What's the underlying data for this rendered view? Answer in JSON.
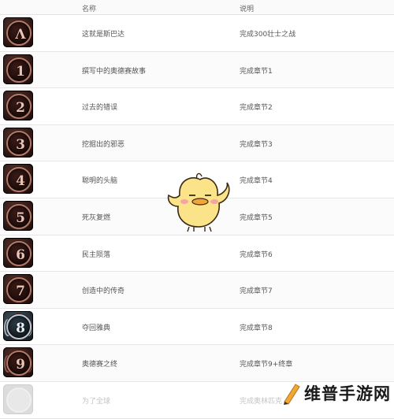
{
  "header": {
    "name_col": "名称",
    "desc_col": "说明"
  },
  "rows": [
    {
      "badge": "spartan-helmet-badge",
      "badge_text": "Λ",
      "name": "这就是斯巴达",
      "desc": "完成300壮士之战"
    },
    {
      "badge": "chapter-1-badge",
      "badge_text": "1",
      "name": "撰写中的奥德赛故事",
      "desc": "完成章节1"
    },
    {
      "badge": "chapter-2-badge",
      "badge_text": "2",
      "name": "过去的错误",
      "desc": "完成章节2"
    },
    {
      "badge": "chapter-3-badge",
      "badge_text": "3",
      "name": "挖掘出的邪恶",
      "desc": "完成章节3"
    },
    {
      "badge": "chapter-4-badge",
      "badge_text": "4",
      "name": "聪明的头脑",
      "desc": "完成章节4"
    },
    {
      "badge": "chapter-5-badge",
      "badge_text": "5",
      "name": "死灰复燃",
      "desc": "完成章节5"
    },
    {
      "badge": "chapter-6-badge",
      "badge_text": "6",
      "name": "民主陨落",
      "desc": "完成章节6"
    },
    {
      "badge": "chapter-7-badge",
      "badge_text": "7",
      "name": "创造中的传奇",
      "desc": "完成章节7"
    },
    {
      "badge": "chapter-8-badge",
      "badge_text": "8",
      "name": "夺回雅典",
      "desc": "完成章节8"
    },
    {
      "badge": "chapter-9-badge",
      "badge_text": "9",
      "name": "奥德赛之终",
      "desc": "完成章节9+终章"
    },
    {
      "badge": "faded-laurel-badge",
      "badge_text": "",
      "name": "为了全球",
      "desc": "完成奥林匹克"
    }
  ],
  "watermark": {
    "text": "维普手游网",
    "colors": {
      "pen": "#f0a832",
      "text": "#1a1a1a"
    }
  },
  "colors": {
    "badge_bronze": "#b07a6a",
    "badge_silver": "#b9c9d6",
    "row_border": "#e6e6e6"
  }
}
